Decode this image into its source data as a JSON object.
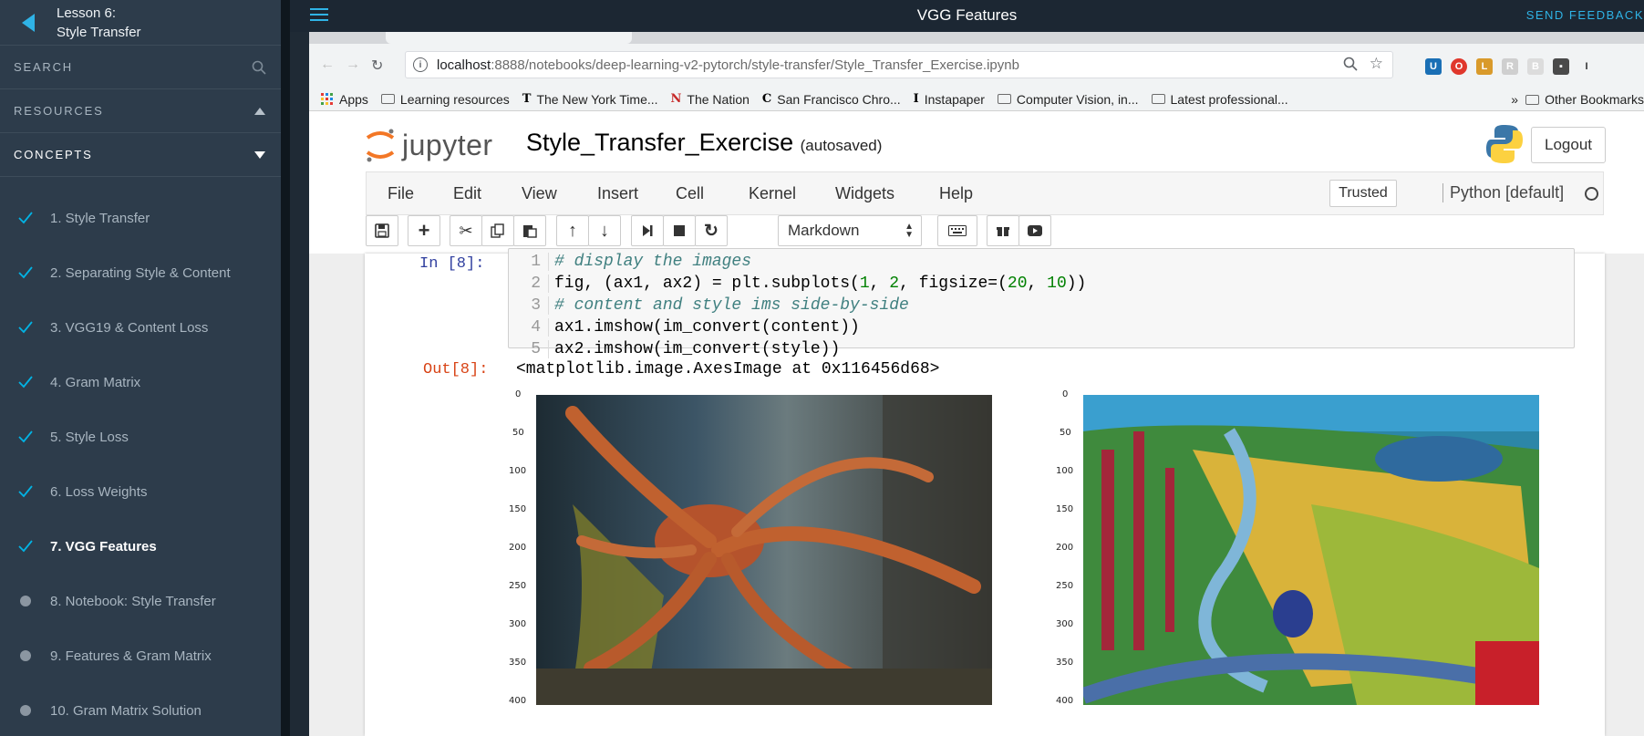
{
  "sidebar": {
    "lesson_label": "Lesson 6:",
    "lesson_title": "Style Transfer",
    "search_label": "SEARCH",
    "resources_label": "RESOURCES",
    "concepts_label": "CONCEPTS",
    "concepts": [
      {
        "label": "1. Style Transfer",
        "status": "done"
      },
      {
        "label": "2. Separating Style & Content",
        "status": "done"
      },
      {
        "label": "3. VGG19 & Content Loss",
        "status": "done"
      },
      {
        "label": "4. Gram Matrix",
        "status": "done"
      },
      {
        "label": "5. Style Loss",
        "status": "done"
      },
      {
        "label": "6. Loss Weights",
        "status": "done"
      },
      {
        "label": "7. VGG Features",
        "status": "active"
      },
      {
        "label": "8. Notebook: Style Transfer",
        "status": "todo"
      },
      {
        "label": "9. Features & Gram Matrix",
        "status": "todo"
      },
      {
        "label": "10. Gram Matrix Solution",
        "status": "todo"
      }
    ]
  },
  "header": {
    "title": "VGG Features",
    "feedback": "SEND FEEDBACK"
  },
  "browser": {
    "url_host": "localhost",
    "url_path": ":8888/notebooks/deep-learning-v2-pytorch/style-transfer/Style_Transfer_Exercise.ipynb",
    "bookmarks": [
      {
        "label": "Apps",
        "icon": "apps-grid-icon"
      },
      {
        "label": "Learning resources",
        "icon": "folder-icon"
      },
      {
        "label": "The New York Time...",
        "icon": "nyt-icon"
      },
      {
        "label": "The Nation",
        "icon": "nation-icon"
      },
      {
        "label": "San Francisco Chro...",
        "icon": "sfchron-icon"
      },
      {
        "label": "Instapaper",
        "icon": "instapaper-icon"
      },
      {
        "label": "Computer Vision, in...",
        "icon": "folder-icon"
      },
      {
        "label": "Latest professional...",
        "icon": "folder-icon"
      }
    ],
    "overflow": "»",
    "other_bookmarks": "Other Bookmarks"
  },
  "jupyter": {
    "logo_text": "jupyter",
    "notebook_name": "Style_Transfer_Exercise",
    "autosaved": "(autosaved)",
    "logout": "Logout",
    "menu": [
      "File",
      "Edit",
      "View",
      "Insert",
      "Cell",
      "Kernel",
      "Widgets",
      "Help"
    ],
    "trusted": "Trusted",
    "kernel": "Python [default]",
    "cell_type": "Markdown"
  },
  "cell": {
    "in_prompt": "In [8]:",
    "out_prompt": "Out[8]:",
    "line_numbers": [
      "1",
      "2",
      "3",
      "4",
      "5"
    ],
    "line1": "# display the images",
    "line2_a": "fig, (ax1, ax2) = plt.subplots(",
    "line2_n1": "1",
    "line2_b": ", ",
    "line2_n2": "2",
    "line2_c": ", figsize=(",
    "line2_n3": "20",
    "line2_d": ", ",
    "line2_n4": "10",
    "line2_e": "))",
    "line3": "# content and style ims side-by-side",
    "line4": "ax1.imshow(im_convert(content))",
    "line5": "ax2.imshow(im_convert(style))",
    "output": "<matplotlib.image.AxesImage at 0x116456d68>"
  },
  "plots": {
    "y_ticks": [
      "0",
      "50",
      "100",
      "150",
      "200",
      "250",
      "300",
      "350",
      "400"
    ]
  }
}
